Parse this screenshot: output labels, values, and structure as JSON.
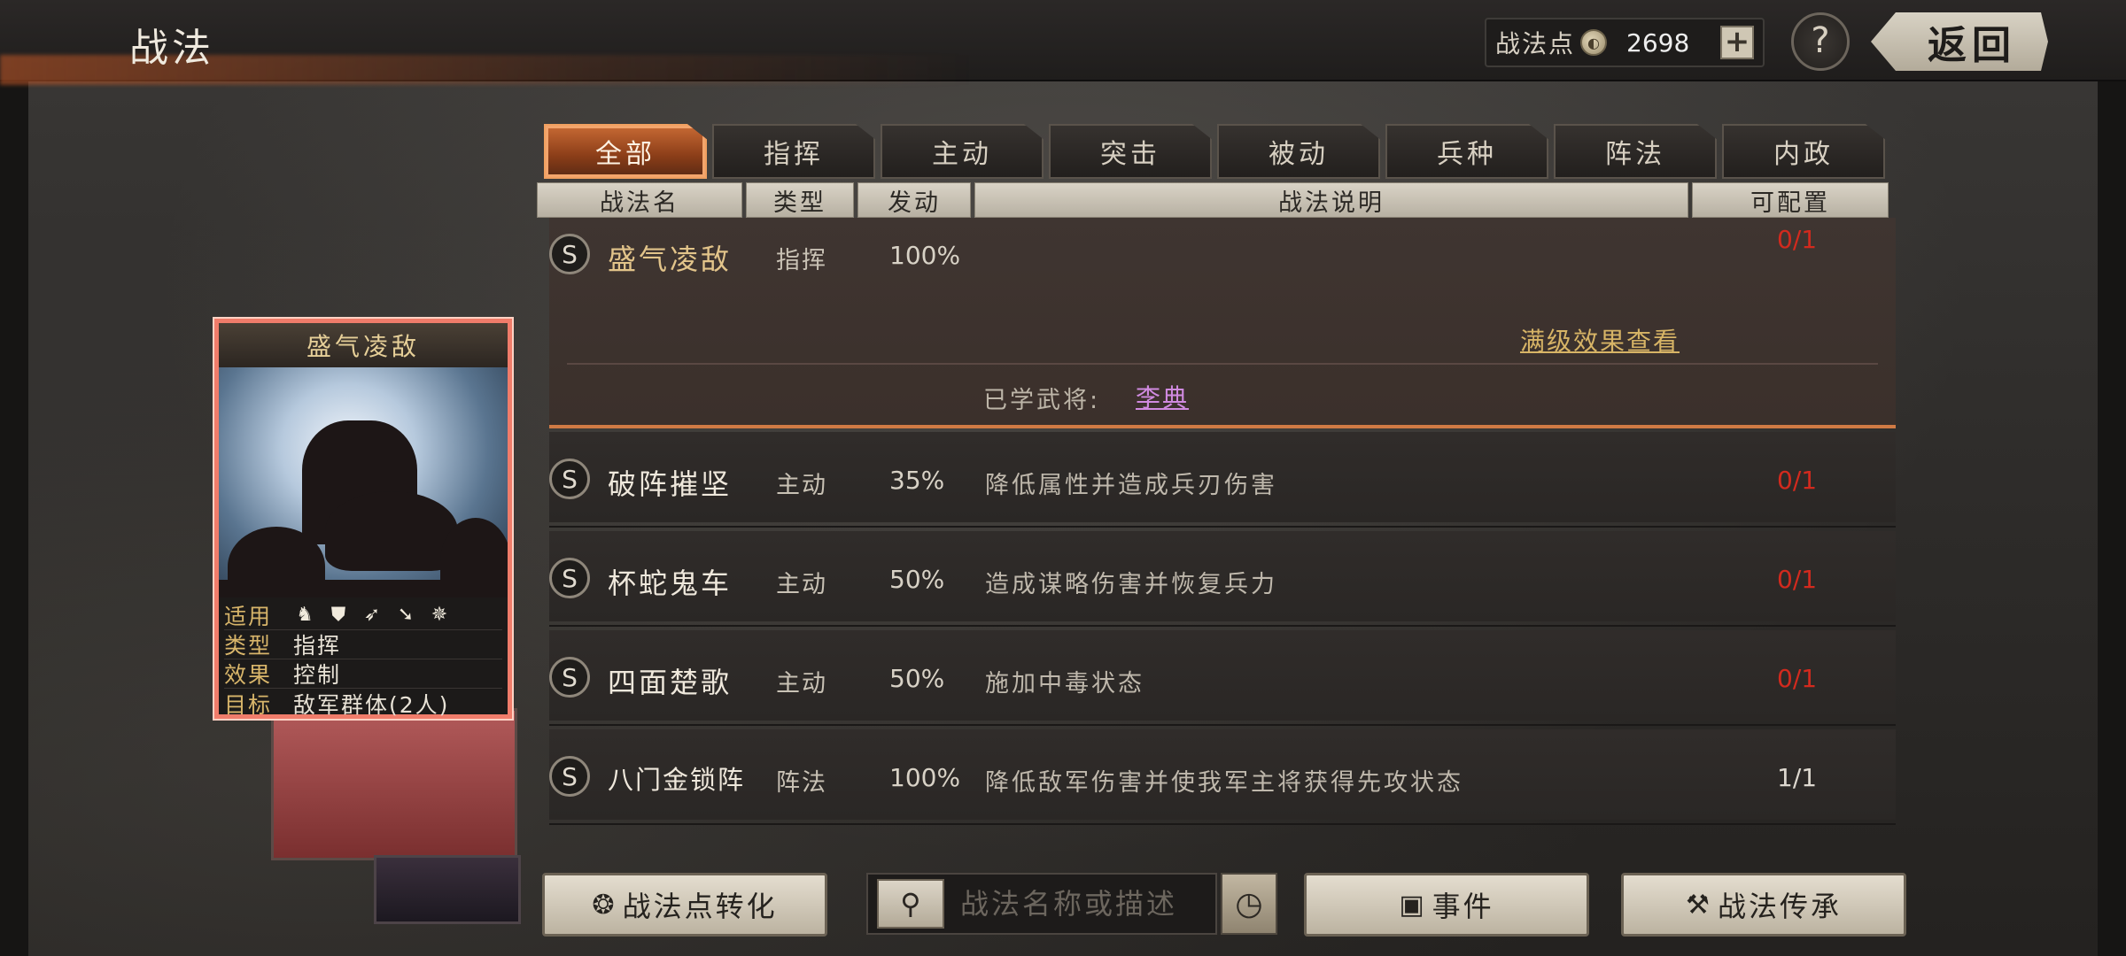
{
  "header": {
    "title": "战法",
    "points_label": "战法点",
    "points_value": "2698",
    "plus": "+",
    "help": "?",
    "back_label": "返回"
  },
  "tabs": [
    {
      "label": "全部",
      "active": true
    },
    {
      "label": "指挥"
    },
    {
      "label": "主动"
    },
    {
      "label": "突击"
    },
    {
      "label": "被动"
    },
    {
      "label": "兵种"
    },
    {
      "label": "阵法"
    },
    {
      "label": "内政"
    }
  ],
  "columns": [
    "战法名",
    "类型",
    "发动",
    "战法说明",
    "可配置"
  ],
  "expanded": {
    "badge": "S",
    "name": "盛气凌敌",
    "type": "指挥",
    "rate": "100%",
    "count": "0/1",
    "full_effect_link": "满级效果查看",
    "learned_label": "已学武将:",
    "learned_general": "李典"
  },
  "rows": [
    {
      "badge": "S",
      "name": "破阵摧坚",
      "type": "主动",
      "rate": "35%",
      "desc": "降低属性并造成兵刃伤害",
      "count": "0/1"
    },
    {
      "badge": "S",
      "name": "杯蛇鬼车",
      "type": "主动",
      "rate": "50%",
      "desc": "造成谋略伤害并恢复兵力",
      "count": "0/1"
    },
    {
      "badge": "S",
      "name": "四面楚歌",
      "type": "主动",
      "rate": "50%",
      "desc": "施加中毒状态",
      "count": "0/1"
    },
    {
      "badge": "S",
      "name": "八门金锁阵",
      "type": "阵法",
      "rate": "100%",
      "desc": "降低敌军伤害并使我军主将获得先攻状态",
      "count": "1/1"
    }
  ],
  "card": {
    "title": "盛气凌敌",
    "applicable_label": "适用",
    "type_label": "类型",
    "type_value": "指挥",
    "effect_label": "效果",
    "effect_value": "控制",
    "target_label": "目标",
    "target_value": "敌军群体(2人)"
  },
  "bottom": {
    "convert_button": "战法点转化",
    "search_placeholder": "战法名称或描述",
    "event_button": "事件",
    "inherit_button": "战法传承"
  },
  "colors": {
    "accent": "#c86a34",
    "count_red": "#d22a1e",
    "gold": "#d7b466",
    "link_purple": "#d08ae0"
  }
}
